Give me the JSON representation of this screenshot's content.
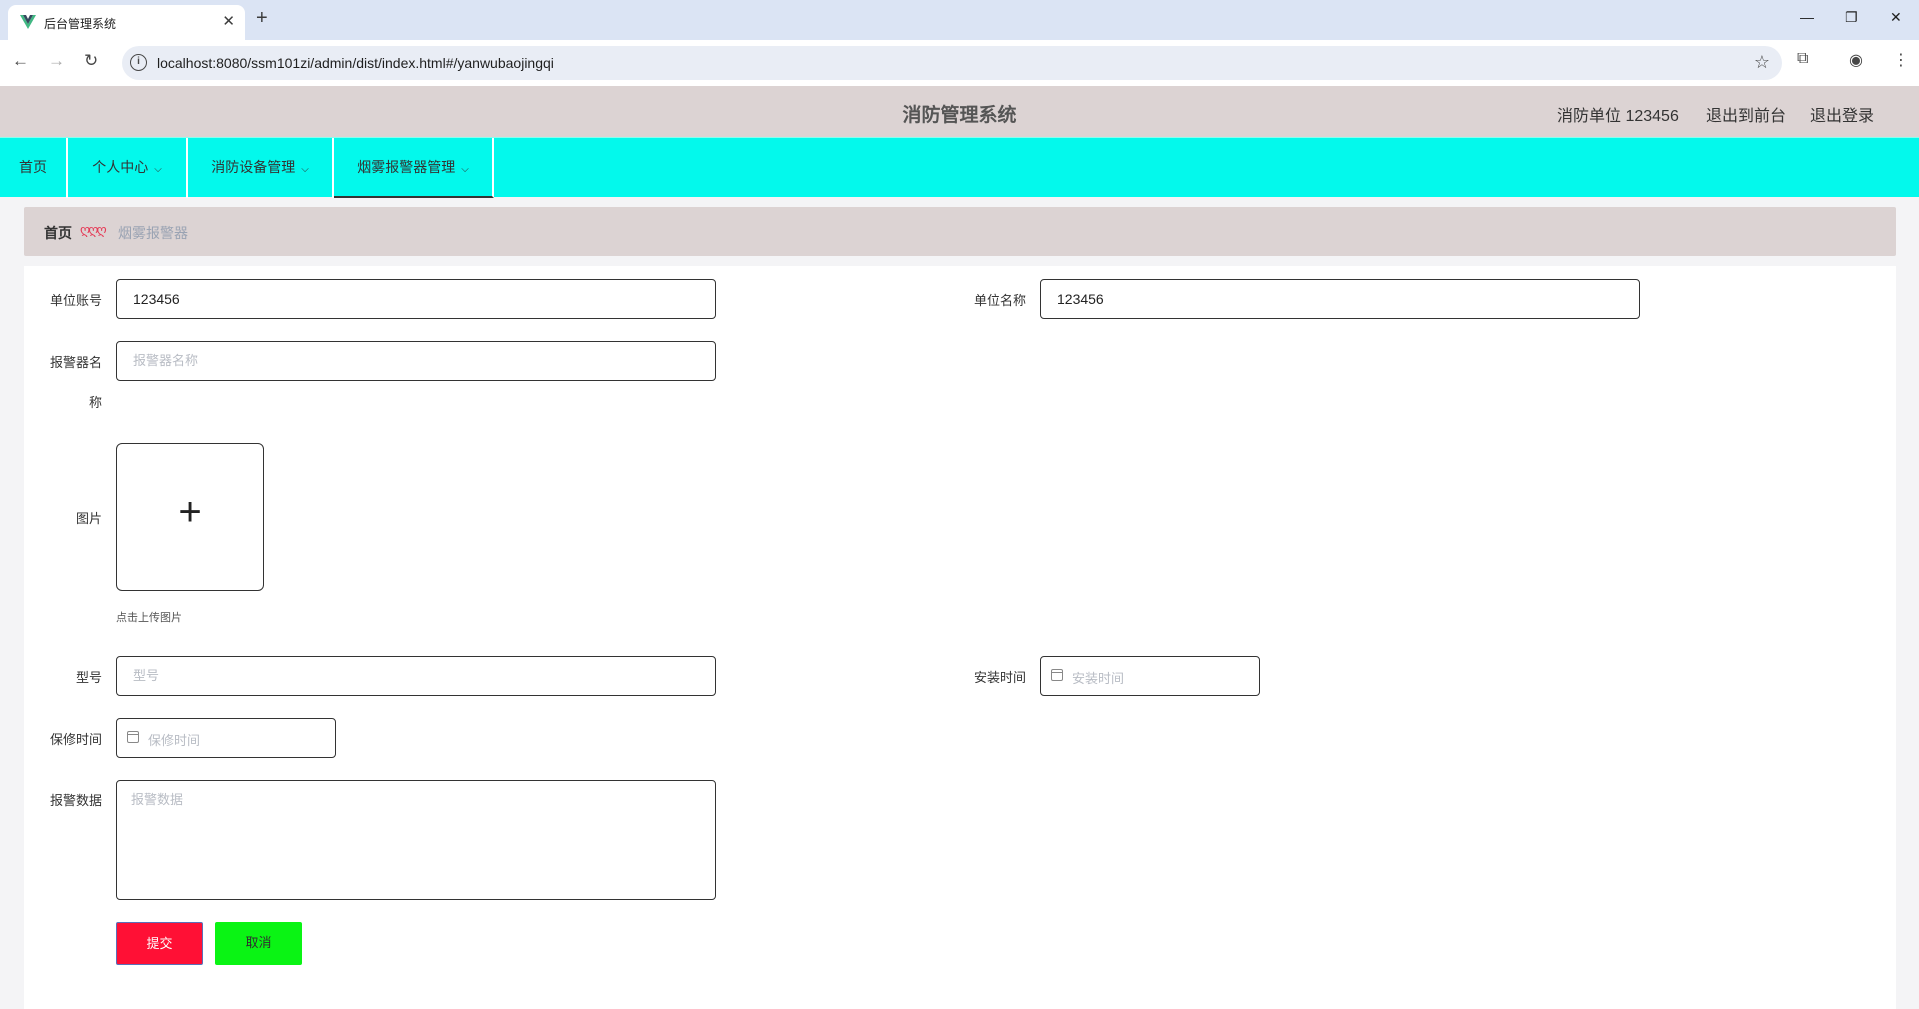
{
  "browser": {
    "tab_title": "后台管理系统",
    "url": "localhost:8080/ssm101zi/admin/dist/index.html#/yanwubaojingqi"
  },
  "header": {
    "title": "消防管理系统",
    "user_label": "消防单位 123456",
    "front_link": "退出到前台",
    "logout_link": "退出登录"
  },
  "menu": {
    "items": [
      {
        "label": "首页"
      },
      {
        "label": "个人中心"
      },
      {
        "label": "消防设备管理"
      },
      {
        "label": "烟雾报警器管理"
      }
    ]
  },
  "breadcrumb": {
    "home": "首页",
    "separator": "ღღღ",
    "current": "烟雾报警器"
  },
  "form": {
    "unit_account": {
      "label": "单位账号",
      "value": "123456"
    },
    "unit_name": {
      "label": "单位名称",
      "value": "123456"
    },
    "alarm_name": {
      "label_line1": "报警器名",
      "label_line2": "称",
      "placeholder": "报警器名称"
    },
    "image": {
      "label": "图片",
      "tip": "点击上传图片"
    },
    "model": {
      "label": "型号",
      "placeholder": "型号"
    },
    "install_time": {
      "label": "安装时间",
      "placeholder": "安装时间"
    },
    "warranty_time": {
      "label": "保修时间",
      "placeholder": "保修时间"
    },
    "alarm_data": {
      "label": "报警数据",
      "placeholder": "报警数据"
    },
    "submit_label": "提交",
    "cancel_label": "取消"
  },
  "colors": {
    "menubar": "#03f9ec",
    "header": "#dcd3d3",
    "submit": "#ff1035",
    "cancel": "#0af414"
  }
}
